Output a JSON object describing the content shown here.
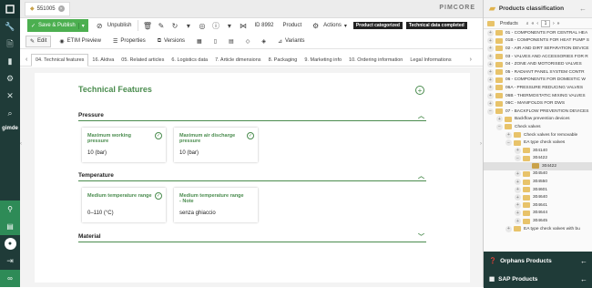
{
  "app": {
    "brand": "PIMCORE",
    "logo_text": "gimde"
  },
  "doc_tab": {
    "label": "551005"
  },
  "toolbar": {
    "save_publish": "Save & Publish",
    "unpublish": "Unpublish",
    "id_label": "ID 8992",
    "type_label": "Product",
    "actions": "Actions",
    "tag1": "Product categorized",
    "tag2": "Technical data completed"
  },
  "subtoolbar": {
    "edit": "Edit",
    "etim": "ETIM Preview",
    "properties": "Properties",
    "versions": "Versions",
    "variants": "Variants"
  },
  "edit_tabs": [
    "04. Technical features",
    "16. Aktiva",
    "05. Related articles",
    "6. Logistics data",
    "7. Article dimensions",
    "8. Packaging",
    "9. Marketing info",
    "10. Ordering information",
    "Legal Informations"
  ],
  "main": {
    "title": "Technical Features",
    "sections": [
      {
        "name": "Pressure"
      },
      {
        "name": "Temperature"
      },
      {
        "name": "Material"
      }
    ],
    "cards": [
      {
        "label": "Maximum working pressure",
        "value": "10 (bar)"
      },
      {
        "label": "Maximum air discharge pressure",
        "value": "10 (bar)"
      },
      {
        "label": "Medium temperature range",
        "value": "0–110 (°C)"
      },
      {
        "label": "Medium temperature range - Note",
        "value": "senza ghiaccio"
      }
    ]
  },
  "right": {
    "title": "Products classification",
    "tools_label": "Products",
    "page": "1",
    "tree": [
      {
        "label": "01 - COMPONENTS FOR CENTRAL HEA",
        "level": 0,
        "exp": "+"
      },
      {
        "label": "01B - COMPONENTS FOR HEAT PUMP S",
        "level": 0,
        "exp": "+"
      },
      {
        "label": "02 - AIR AND DIRT SEPARATION DEVICE",
        "level": 0,
        "exp": "+"
      },
      {
        "label": "03 - VALVES AND ACCESSORIES FOR R",
        "level": 0,
        "exp": "+"
      },
      {
        "label": "04 - ZONE AND MOTORISED VALVES",
        "level": 0,
        "exp": "+"
      },
      {
        "label": "05 - RADIANT PANEL SYSTEM CONTR",
        "level": 0,
        "exp": "+"
      },
      {
        "label": "06 - COMPONENTS FOR DOMESTIC W",
        "level": 0,
        "exp": "+"
      },
      {
        "label": "06A - PRESSURE REDUCING VALVES",
        "level": 0,
        "exp": "+"
      },
      {
        "label": "06B - THERMOSTATIC MIXING VALVES",
        "level": 0,
        "exp": "+"
      },
      {
        "label": "06C - MANIFOLDS FOR DWS",
        "level": 0,
        "exp": "+"
      },
      {
        "label": "07 - BACKFLOW PREVENTION DEVICES",
        "level": 0,
        "exp": "−"
      },
      {
        "label": "Backflow prevention devices",
        "level": 1,
        "exp": "+"
      },
      {
        "label": "Check valves",
        "level": 1,
        "exp": "−"
      },
      {
        "label": "Check valves for removable",
        "level": 2,
        "exp": "+"
      },
      {
        "label": "EA type check valves",
        "level": 2,
        "exp": "−"
      },
      {
        "label": "304140",
        "level": 3,
        "exp": "+"
      },
      {
        "label": "304422",
        "level": 3,
        "exp": "−"
      },
      {
        "label": "304422",
        "level": 4,
        "exp": "",
        "sel": true
      },
      {
        "label": "304540",
        "level": 3,
        "exp": "+"
      },
      {
        "label": "304550",
        "level": 3,
        "exp": "+"
      },
      {
        "label": "304601",
        "level": 3,
        "exp": "+"
      },
      {
        "label": "304640",
        "level": 3,
        "exp": "+"
      },
      {
        "label": "304641",
        "level": 3,
        "exp": "+"
      },
      {
        "label": "304644",
        "level": 3,
        "exp": "+"
      },
      {
        "label": "304645",
        "level": 3,
        "exp": "+"
      },
      {
        "label": "EA type check valves with bu",
        "level": 2,
        "exp": "+"
      }
    ],
    "orphans": "Orphans Products",
    "sap": "SAP Products"
  }
}
